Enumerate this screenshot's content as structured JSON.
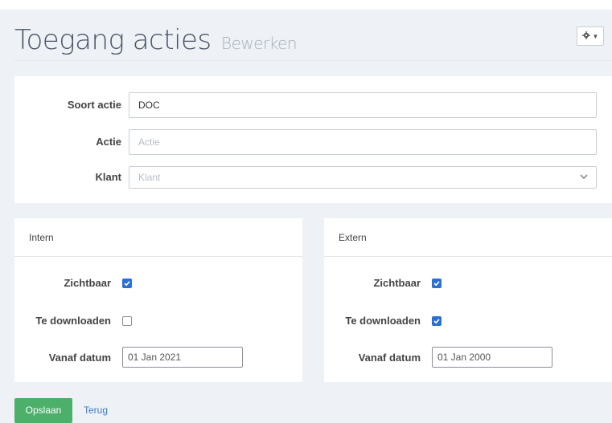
{
  "header": {
    "title": "Toegang acties",
    "subtitle": "Bewerken",
    "settings_icon": "gear-icon"
  },
  "form": {
    "soort_actie": {
      "label": "Soort actie",
      "value": "DOC"
    },
    "actie": {
      "label": "Actie",
      "placeholder": "Actie"
    },
    "klant": {
      "label": "Klant",
      "placeholder": "Klant"
    }
  },
  "intern": {
    "heading": "Intern",
    "zichtbaar": {
      "label": "Zichtbaar",
      "checked": true
    },
    "te_downloaden": {
      "label": "Te downloaden",
      "checked": false
    },
    "vanaf_datum": {
      "label": "Vanaf datum",
      "value": "01 Jan 2021"
    }
  },
  "extern": {
    "heading": "Extern",
    "zichtbaar": {
      "label": "Zichtbaar",
      "checked": true
    },
    "te_downloaden": {
      "label": "Te downloaden",
      "checked": true
    },
    "vanaf_datum": {
      "label": "Vanaf datum",
      "value": "01 Jan 2000"
    }
  },
  "actions": {
    "save_label": "Opslaan",
    "back_label": "Terug"
  },
  "colors": {
    "accent": "#2a6fd6",
    "save": "#4caf6a",
    "link": "#3a7bd5"
  }
}
